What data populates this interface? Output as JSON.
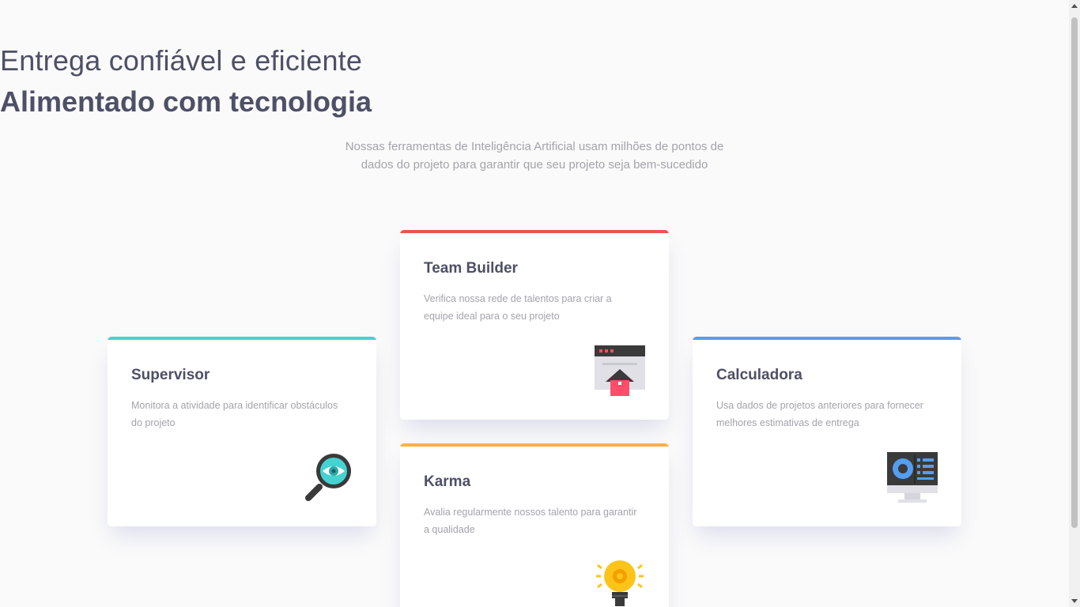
{
  "hero": {
    "title_light": "Entrega confiável e eficiente",
    "title_bold": "Alimentado com tecnologia",
    "subtitle": "Nossas ferramentas de Inteligência Artificial usam milhões de pontos de dados do projeto para garantir que seu projeto seja bem-sucedido"
  },
  "cards": {
    "supervisor": {
      "title": "Supervisor",
      "description": "Monitora a atividade para identificar obstáculos do projeto",
      "accent": "#44d3d2",
      "icon": "magnifier-eye-icon"
    },
    "team_builder": {
      "title": "Team Builder",
      "description": "Verifica nossa rede de talentos para criar a equipe ideal para o seu projeto",
      "accent": "#ea5454",
      "icon": "team-builder-window-icon"
    },
    "calculadora": {
      "title": "Calculadora",
      "description": "Usa dados de projetos anteriores para fornecer melhores estimativas de entrega",
      "accent": "#549ef2",
      "icon": "monitor-dashboard-icon"
    },
    "karma": {
      "title": "Karma",
      "description": "Avalia regularmente nossos talento para garantir a qualidade",
      "accent": "#fcaf4a",
      "icon": "lightbulb-icon"
    }
  }
}
